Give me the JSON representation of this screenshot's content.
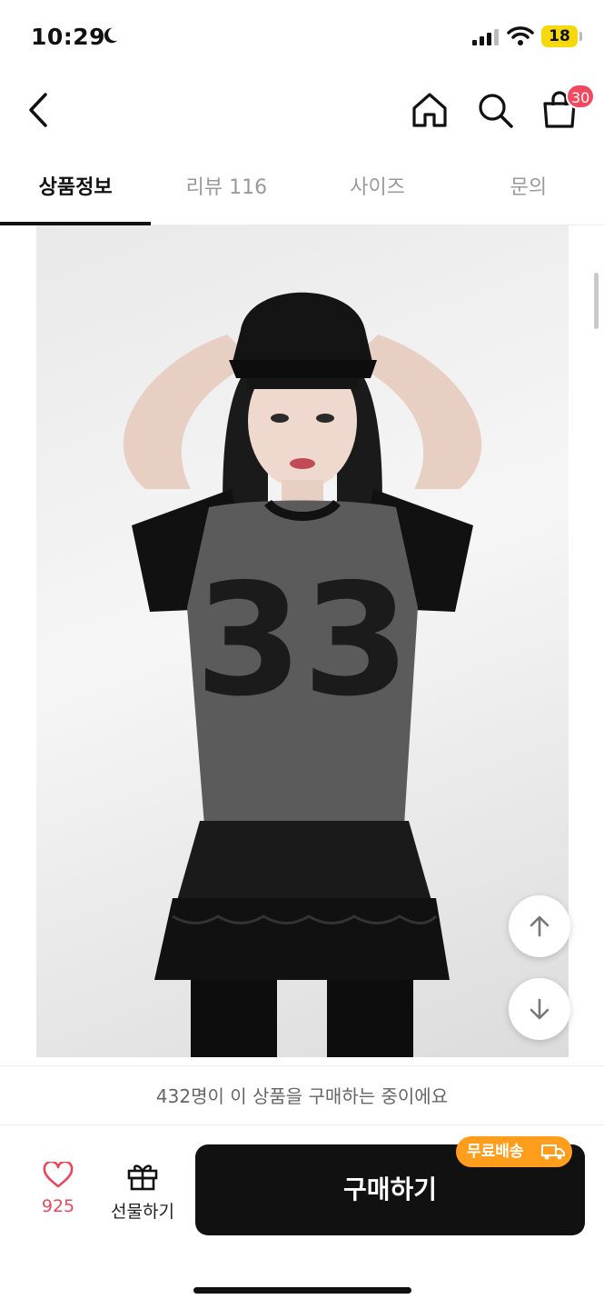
{
  "status_bar": {
    "time": "10:29",
    "battery": "18"
  },
  "nav": {
    "cart_count": "30"
  },
  "tabs": [
    {
      "label": "상품정보",
      "active": true
    },
    {
      "label": "리뷰 116",
      "active": false
    },
    {
      "label": "사이즈",
      "active": false
    },
    {
      "label": "문의",
      "active": false
    }
  ],
  "product_image": {
    "shirt_number": "33"
  },
  "buyer_notice": "432명이 이 상품을 구매하는 중이에요",
  "bottom_bar": {
    "like_count": "925",
    "gift_label": "선물하기",
    "buy_label": "구매하기",
    "free_shipping_label": "무료배송"
  },
  "colors": {
    "accent": "#f2495f",
    "badge_orange": "#ff9d1c",
    "buy_button": "#111111"
  },
  "icons": [
    "moon-icon",
    "signal-icon",
    "wifi-icon",
    "back-arrow-icon",
    "home-icon",
    "search-icon",
    "shopping-bag-icon",
    "arrow-up-icon",
    "arrow-down-icon",
    "heart-icon",
    "gift-icon",
    "truck-icon"
  ]
}
